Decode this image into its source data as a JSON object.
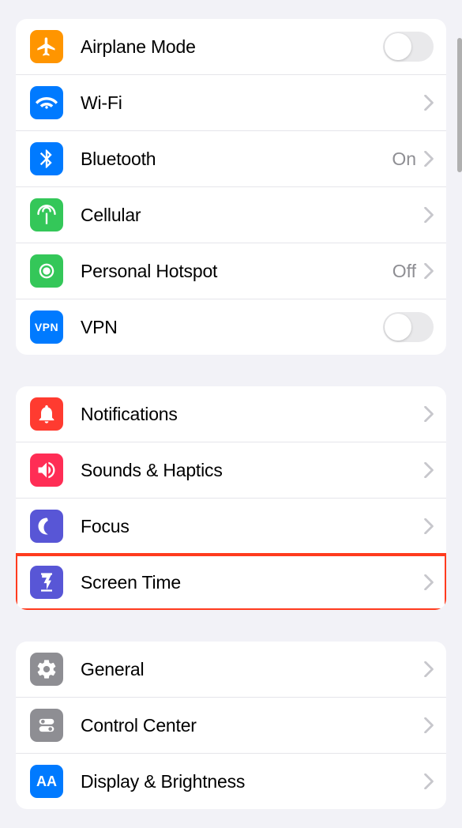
{
  "groups": [
    {
      "items": [
        {
          "id": "airplane",
          "label": "Airplane Mode",
          "iconColor": "#ff9500",
          "type": "toggle"
        },
        {
          "id": "wifi",
          "label": "Wi-Fi",
          "iconColor": "#007aff",
          "type": "link",
          "value": ""
        },
        {
          "id": "bluetooth",
          "label": "Bluetooth",
          "iconColor": "#007aff",
          "type": "link",
          "value": "On"
        },
        {
          "id": "cellular",
          "label": "Cellular",
          "iconColor": "#34c759",
          "type": "link",
          "value": ""
        },
        {
          "id": "hotspot",
          "label": "Personal Hotspot",
          "iconColor": "#34c759",
          "type": "link",
          "value": "Off"
        },
        {
          "id": "vpn",
          "label": "VPN",
          "iconColor": "#007aff",
          "type": "toggle"
        }
      ]
    },
    {
      "items": [
        {
          "id": "notifications",
          "label": "Notifications",
          "iconColor": "#ff3b30",
          "type": "link",
          "value": ""
        },
        {
          "id": "sounds",
          "label": "Sounds & Haptics",
          "iconColor": "#ff2d55",
          "type": "link",
          "value": ""
        },
        {
          "id": "focus",
          "label": "Focus",
          "iconColor": "#5856d6",
          "type": "link",
          "value": ""
        },
        {
          "id": "screentime",
          "label": "Screen Time",
          "iconColor": "#5856d6",
          "type": "link",
          "value": "",
          "highlight": true
        }
      ]
    },
    {
      "items": [
        {
          "id": "general",
          "label": "General",
          "iconColor": "#8e8e93",
          "type": "link",
          "value": ""
        },
        {
          "id": "controlcenter",
          "label": "Control Center",
          "iconColor": "#8e8e93",
          "type": "link",
          "value": ""
        },
        {
          "id": "display",
          "label": "Display & Brightness",
          "iconColor": "#007aff",
          "type": "link",
          "value": ""
        }
      ]
    }
  ]
}
